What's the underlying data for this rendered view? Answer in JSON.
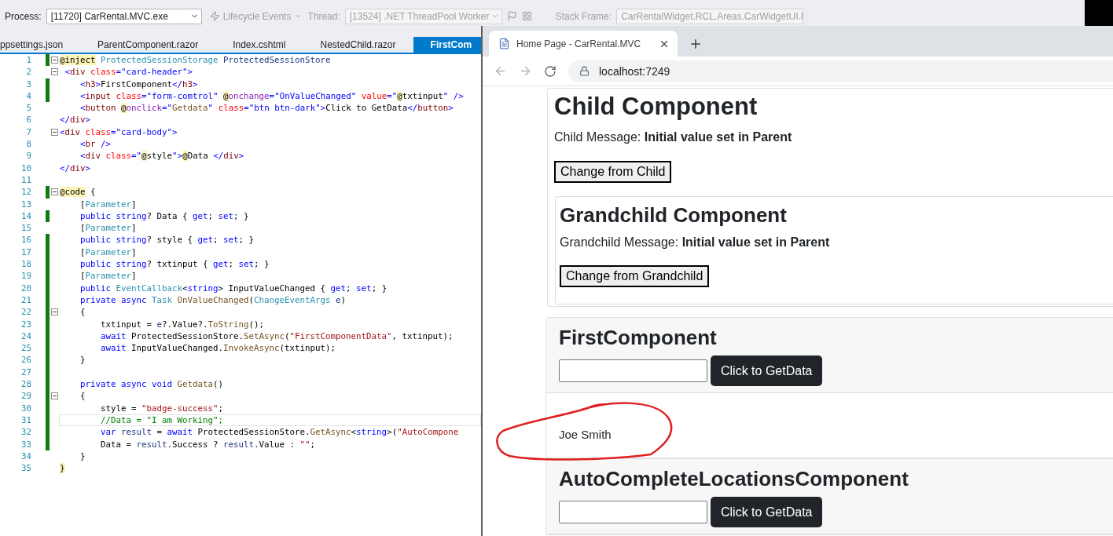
{
  "toolbar": {
    "process_label": "Process:",
    "process": {
      "value": "[11720] CarRental.MVC.exe",
      "disabled": false
    },
    "lifecycle_events": {
      "label": "Lifecycle Events",
      "disabled": true
    },
    "thread_label": "Thread:",
    "thread": {
      "value": "[13524] .NET ThreadPool Worker",
      "disabled": true
    },
    "stack_frame_label": "Stack Frame:",
    "stack_frame": {
      "value": "CarRentalWidget.RCL.Areas.CarWidgetUI.I",
      "disabled": true
    }
  },
  "editor": {
    "tabs": [
      {
        "label": "ppsettings.json",
        "selected": false
      },
      {
        "label": "ParentComponent.razor",
        "selected": false
      },
      {
        "label": "Index.cshtml",
        "selected": false
      },
      {
        "label": "NestedChild.razor",
        "selected": false
      },
      {
        "label": "FirstCom",
        "selected": true
      }
    ],
    "lines": [
      {
        "number": "1",
        "changed": true,
        "fold": true,
        "current": false,
        "tokens": [
          {
            "kind": "razor",
            "text": "@inject"
          },
          {
            "kind": "type",
            "text": " ProtectedSessionStorage"
          },
          {
            "kind": "local",
            "text": " ProtectedSessionStore"
          }
        ]
      },
      {
        "number": "2",
        "changed": false,
        "fold": true,
        "current": false,
        "tokens": [
          {
            "kind": "punct",
            "text": " <"
          },
          {
            "kind": "tag",
            "text": "div"
          },
          {
            "kind": "attr",
            "text": " class"
          },
          {
            "kind": "punct",
            "text": "="
          },
          {
            "kind": "value",
            "text": "\"card-header\""
          },
          {
            "kind": "punct",
            "text": ">"
          }
        ]
      },
      {
        "number": "3",
        "changed": true,
        "fold": false,
        "current": false,
        "tokens": [
          {
            "kind": "punct",
            "text": "    <"
          },
          {
            "kind": "tag",
            "text": "h3"
          },
          {
            "kind": "punct",
            "text": ">"
          },
          {
            "kind": "plain",
            "text": "FirstComponent"
          },
          {
            "kind": "punct",
            "text": "</"
          },
          {
            "kind": "tag",
            "text": "h3"
          },
          {
            "kind": "punct",
            "text": ">"
          }
        ]
      },
      {
        "number": "4",
        "changed": true,
        "fold": false,
        "current": false,
        "tokens": [
          {
            "kind": "punct",
            "text": "    <"
          },
          {
            "kind": "tag",
            "text": "input"
          },
          {
            "kind": "attr",
            "text": " class"
          },
          {
            "kind": "punct",
            "text": "="
          },
          {
            "kind": "value",
            "text": "\"form-comtrol\" "
          },
          {
            "kind": "razor",
            "text": "@"
          },
          {
            "kind": "directive",
            "text": "onchange"
          },
          {
            "kind": "punct",
            "text": "="
          },
          {
            "kind": "value",
            "text": "\"OnValueChanged\""
          },
          {
            "kind": "attr",
            "text": " value"
          },
          {
            "kind": "punct",
            "text": "="
          },
          {
            "kind": "value",
            "text": "\""
          },
          {
            "kind": "razor",
            "text": "@"
          },
          {
            "kind": "plain",
            "text": "txtinput"
          },
          {
            "kind": "value",
            "text": "\""
          },
          {
            "kind": "punct",
            "text": " />"
          }
        ]
      },
      {
        "number": "5",
        "changed": false,
        "fold": false,
        "current": false,
        "tokens": [
          {
            "kind": "punct",
            "text": "    <"
          },
          {
            "kind": "tag",
            "text": "button "
          },
          {
            "kind": "razor",
            "text": "@"
          },
          {
            "kind": "directive",
            "text": "onclick"
          },
          {
            "kind": "punct",
            "text": "="
          },
          {
            "kind": "value",
            "text": "\""
          },
          {
            "kind": "method",
            "text": "Getdata"
          },
          {
            "kind": "value",
            "text": "\""
          },
          {
            "kind": "attr",
            "text": " class"
          },
          {
            "kind": "punct",
            "text": "="
          },
          {
            "kind": "value",
            "text": "\"btn btn-dark\""
          },
          {
            "kind": "punct",
            "text": ">"
          },
          {
            "kind": "plain",
            "text": "Click to GetData"
          },
          {
            "kind": "punct",
            "text": "</"
          },
          {
            "kind": "tag",
            "text": "button"
          },
          {
            "kind": "punct",
            "text": ">"
          }
        ]
      },
      {
        "number": "6",
        "changed": false,
        "fold": false,
        "current": false,
        "tokens": [
          {
            "kind": "punct",
            "text": "</"
          },
          {
            "kind": "tag",
            "text": "div"
          },
          {
            "kind": "punct",
            "text": ">"
          }
        ]
      },
      {
        "number": "7",
        "changed": false,
        "fold": true,
        "current": false,
        "tokens": [
          {
            "kind": "punct",
            "text": "<"
          },
          {
            "kind": "tag",
            "text": "div"
          },
          {
            "kind": "attr",
            "text": " class"
          },
          {
            "kind": "punct",
            "text": "="
          },
          {
            "kind": "value",
            "text": "\"card-body\""
          },
          {
            "kind": "punct",
            "text": ">"
          }
        ]
      },
      {
        "number": "8",
        "changed": false,
        "fold": false,
        "current": false,
        "tokens": [
          {
            "kind": "punct",
            "text": "    <"
          },
          {
            "kind": "tag",
            "text": "br"
          },
          {
            "kind": "punct",
            "text": " />"
          }
        ]
      },
      {
        "number": "9",
        "changed": false,
        "fold": false,
        "current": false,
        "tokens": [
          {
            "kind": "punct",
            "text": "    <"
          },
          {
            "kind": "tag",
            "text": "div"
          },
          {
            "kind": "attr",
            "text": " class"
          },
          {
            "kind": "punct",
            "text": "="
          },
          {
            "kind": "value",
            "text": "\""
          },
          {
            "kind": "razor",
            "text": "@"
          },
          {
            "kind": "plain",
            "text": "style"
          },
          {
            "kind": "value",
            "text": "\""
          },
          {
            "kind": "punct",
            "text": ">"
          },
          {
            "kind": "razor",
            "text": "@"
          },
          {
            "kind": "plain",
            "text": "Data "
          },
          {
            "kind": "punct",
            "text": "</"
          },
          {
            "kind": "tag",
            "text": "div"
          },
          {
            "kind": "punct",
            "text": ">"
          }
        ]
      },
      {
        "number": "10",
        "changed": false,
        "fold": false,
        "current": false,
        "tokens": [
          {
            "kind": "punct",
            "text": "</"
          },
          {
            "kind": "tag",
            "text": "div"
          },
          {
            "kind": "punct",
            "text": ">"
          }
        ]
      },
      {
        "number": "11",
        "changed": false,
        "fold": false,
        "current": false
      },
      {
        "number": "12",
        "changed": true,
        "fold": true,
        "current": false,
        "tokens": [
          {
            "kind": "razor",
            "text": "@code"
          },
          {
            "kind": "plain",
            "text": " {"
          }
        ]
      },
      {
        "number": "13",
        "changed": false,
        "fold": false,
        "current": false,
        "tokens": [
          {
            "kind": "plain",
            "text": "    ["
          },
          {
            "kind": "type",
            "text": "Parameter"
          },
          {
            "kind": "plain",
            "text": "]"
          }
        ]
      },
      {
        "number": "14",
        "changed": true,
        "fold": false,
        "current": false,
        "tokens": [
          {
            "kind": "keyword",
            "text": "    public string"
          },
          {
            "kind": "plain",
            "text": "? Data { "
          },
          {
            "kind": "keyword",
            "text": "get"
          },
          {
            "kind": "plain",
            "text": "; "
          },
          {
            "kind": "keyword",
            "text": "set"
          },
          {
            "kind": "plain",
            "text": "; }"
          }
        ]
      },
      {
        "number": "15",
        "changed": false,
        "fold": false,
        "current": false,
        "tokens": [
          {
            "kind": "plain",
            "text": "    ["
          },
          {
            "kind": "type",
            "text": "Parameter"
          },
          {
            "kind": "plain",
            "text": "]"
          }
        ]
      },
      {
        "number": "16",
        "changed": true,
        "fold": false,
        "current": false,
        "tokens": [
          {
            "kind": "keyword",
            "text": "    public string"
          },
          {
            "kind": "plain",
            "text": "? style { "
          },
          {
            "kind": "keyword",
            "text": "get"
          },
          {
            "kind": "plain",
            "text": "; "
          },
          {
            "kind": "keyword",
            "text": "set"
          },
          {
            "kind": "plain",
            "text": "; }"
          }
        ]
      },
      {
        "number": "17",
        "changed": true,
        "fold": false,
        "current": false,
        "tokens": [
          {
            "kind": "plain",
            "text": "    ["
          },
          {
            "kind": "type",
            "text": "Parameter"
          },
          {
            "kind": "plain",
            "text": "]"
          }
        ]
      },
      {
        "number": "18",
        "changed": true,
        "fold": false,
        "current": false,
        "tokens": [
          {
            "kind": "keyword",
            "text": "    public string"
          },
          {
            "kind": "plain",
            "text": "? txtinput { "
          },
          {
            "kind": "keyword",
            "text": "get"
          },
          {
            "kind": "plain",
            "text": "; "
          },
          {
            "kind": "keyword",
            "text": "set"
          },
          {
            "kind": "plain",
            "text": "; }"
          }
        ]
      },
      {
        "number": "19",
        "changed": true,
        "fold": false,
        "current": false,
        "tokens": [
          {
            "kind": "plain",
            "text": "    ["
          },
          {
            "kind": "type",
            "text": "Parameter"
          },
          {
            "kind": "plain",
            "text": "]"
          }
        ]
      },
      {
        "number": "20",
        "changed": true,
        "fold": false,
        "current": false,
        "tokens": [
          {
            "kind": "keyword",
            "text": "    public"
          },
          {
            "kind": "type",
            "text": " EventCallback"
          },
          {
            "kind": "plain",
            "text": "<"
          },
          {
            "kind": "keyword",
            "text": "string"
          },
          {
            "kind": "plain",
            "text": "> InputValueChanged { "
          },
          {
            "kind": "keyword",
            "text": "get"
          },
          {
            "kind": "plain",
            "text": "; "
          },
          {
            "kind": "keyword",
            "text": "set"
          },
          {
            "kind": "plain",
            "text": "; }"
          }
        ]
      },
      {
        "number": "21",
        "changed": true,
        "fold": false,
        "current": false,
        "tokens": [
          {
            "kind": "keyword",
            "text": "    private async"
          },
          {
            "kind": "type",
            "text": " Task"
          },
          {
            "kind": "method",
            "text": " OnValueChanged"
          },
          {
            "kind": "plain",
            "text": "("
          },
          {
            "kind": "type",
            "text": "ChangeEventArgs"
          },
          {
            "kind": "local",
            "text": " e"
          },
          {
            "kind": "plain",
            "text": ")"
          }
        ]
      },
      {
        "number": "22",
        "changed": true,
        "fold": true,
        "current": false,
        "tokens": [
          {
            "kind": "plain",
            "text": "    {"
          }
        ]
      },
      {
        "number": "23",
        "changed": true,
        "fold": false,
        "current": false,
        "tokens": [
          {
            "kind": "plain",
            "text": "        txtinput = "
          },
          {
            "kind": "local",
            "text": "e"
          },
          {
            "kind": "plain",
            "text": "?.Value?."
          },
          {
            "kind": "method",
            "text": "ToString"
          },
          {
            "kind": "plain",
            "text": "();"
          }
        ]
      },
      {
        "number": "24",
        "changed": true,
        "fold": false,
        "current": false,
        "tokens": [
          {
            "kind": "keyword",
            "text": "        await"
          },
          {
            "kind": "plain",
            "text": " ProtectedSessionStore."
          },
          {
            "kind": "method",
            "text": "SetAsync"
          },
          {
            "kind": "plain",
            "text": "("
          },
          {
            "kind": "string",
            "text": "\"FirstComponentData\""
          },
          {
            "kind": "plain",
            "text": ", txtinput);"
          }
        ]
      },
      {
        "number": "25",
        "changed": true,
        "fold": false,
        "current": false,
        "tokens": [
          {
            "kind": "keyword",
            "text": "        await"
          },
          {
            "kind": "plain",
            "text": " InputValueChanged."
          },
          {
            "kind": "method",
            "text": "InvokeAsync"
          },
          {
            "kind": "plain",
            "text": "(txtinput);"
          }
        ]
      },
      {
        "number": "26",
        "changed": true,
        "fold": false,
        "current": false,
        "tokens": [
          {
            "kind": "plain",
            "text": "    }"
          }
        ]
      },
      {
        "number": "27",
        "changed": true,
        "fold": false,
        "current": false
      },
      {
        "number": "28",
        "changed": true,
        "fold": false,
        "current": false,
        "tokens": [
          {
            "kind": "keyword",
            "text": "    private async void"
          },
          {
            "kind": "method",
            "text": " Getdata"
          },
          {
            "kind": "plain",
            "text": "()"
          }
        ]
      },
      {
        "number": "29",
        "changed": true,
        "fold": true,
        "current": false,
        "tokens": [
          {
            "kind": "plain",
            "text": "    {"
          }
        ]
      },
      {
        "number": "30",
        "changed": true,
        "fold": false,
        "current": false,
        "tokens": [
          {
            "kind": "plain",
            "text": "        style = "
          },
          {
            "kind": "string",
            "text": "\"badge-success\""
          },
          {
            "kind": "plain",
            "text": ";"
          }
        ]
      },
      {
        "number": "31",
        "changed": true,
        "fold": false,
        "current": true,
        "tokens": [
          {
            "kind": "comment",
            "text": "        //Data = \"I am Working\";"
          }
        ]
      },
      {
        "number": "32",
        "changed": true,
        "fold": false,
        "current": false,
        "tokens": [
          {
            "kind": "keyword",
            "text": "        var"
          },
          {
            "kind": "local",
            "text": " result"
          },
          {
            "kind": "plain",
            "text": " = "
          },
          {
            "kind": "keyword",
            "text": "await"
          },
          {
            "kind": "plain",
            "text": " ProtectedSessionStore."
          },
          {
            "kind": "method",
            "text": "GetAsync"
          },
          {
            "kind": "plain",
            "text": "<"
          },
          {
            "kind": "keyword",
            "text": "string"
          },
          {
            "kind": "plain",
            "text": ">("
          },
          {
            "kind": "string",
            "text": "\"AutoCompone"
          }
        ]
      },
      {
        "number": "33",
        "changed": true,
        "fold": false,
        "current": false,
        "tokens": [
          {
            "kind": "plain",
            "text": "        Data = "
          },
          {
            "kind": "local",
            "text": "result"
          },
          {
            "kind": "plain",
            "text": ".Success ? "
          },
          {
            "kind": "local",
            "text": "result"
          },
          {
            "kind": "plain",
            "text": ".Value : "
          },
          {
            "kind": "string",
            "text": "\"\""
          },
          {
            "kind": "plain",
            "text": ";"
          }
        ]
      },
      {
        "number": "34",
        "changed": false,
        "fold": false,
        "current": false,
        "tokens": [
          {
            "kind": "plain",
            "text": "    }"
          }
        ]
      },
      {
        "number": "35",
        "changed": false,
        "fold": false,
        "current": false,
        "tokens": [
          {
            "kind": "razor",
            "text": "}"
          }
        ]
      }
    ]
  },
  "browser": {
    "tab_title": "Home Page - CarRental.MVC",
    "address": "localhost:7249",
    "child": {
      "title": "Child Component",
      "message": "Child Message: **Initial value set in Parent**",
      "button": "Change from Child",
      "grandchild": {
        "title": "Grandchild Component",
        "message": "Grandchild Message: **Initial value set in Parent**",
        "button": "Change from Grandchild"
      }
    },
    "first_component": {
      "title": "FirstComponent",
      "button": "Click to GetData",
      "data": "Joe Smith"
    },
    "autocomplete": {
      "title": "AutoCompleteLocationsComponent",
      "button": "Click to GetData"
    }
  }
}
